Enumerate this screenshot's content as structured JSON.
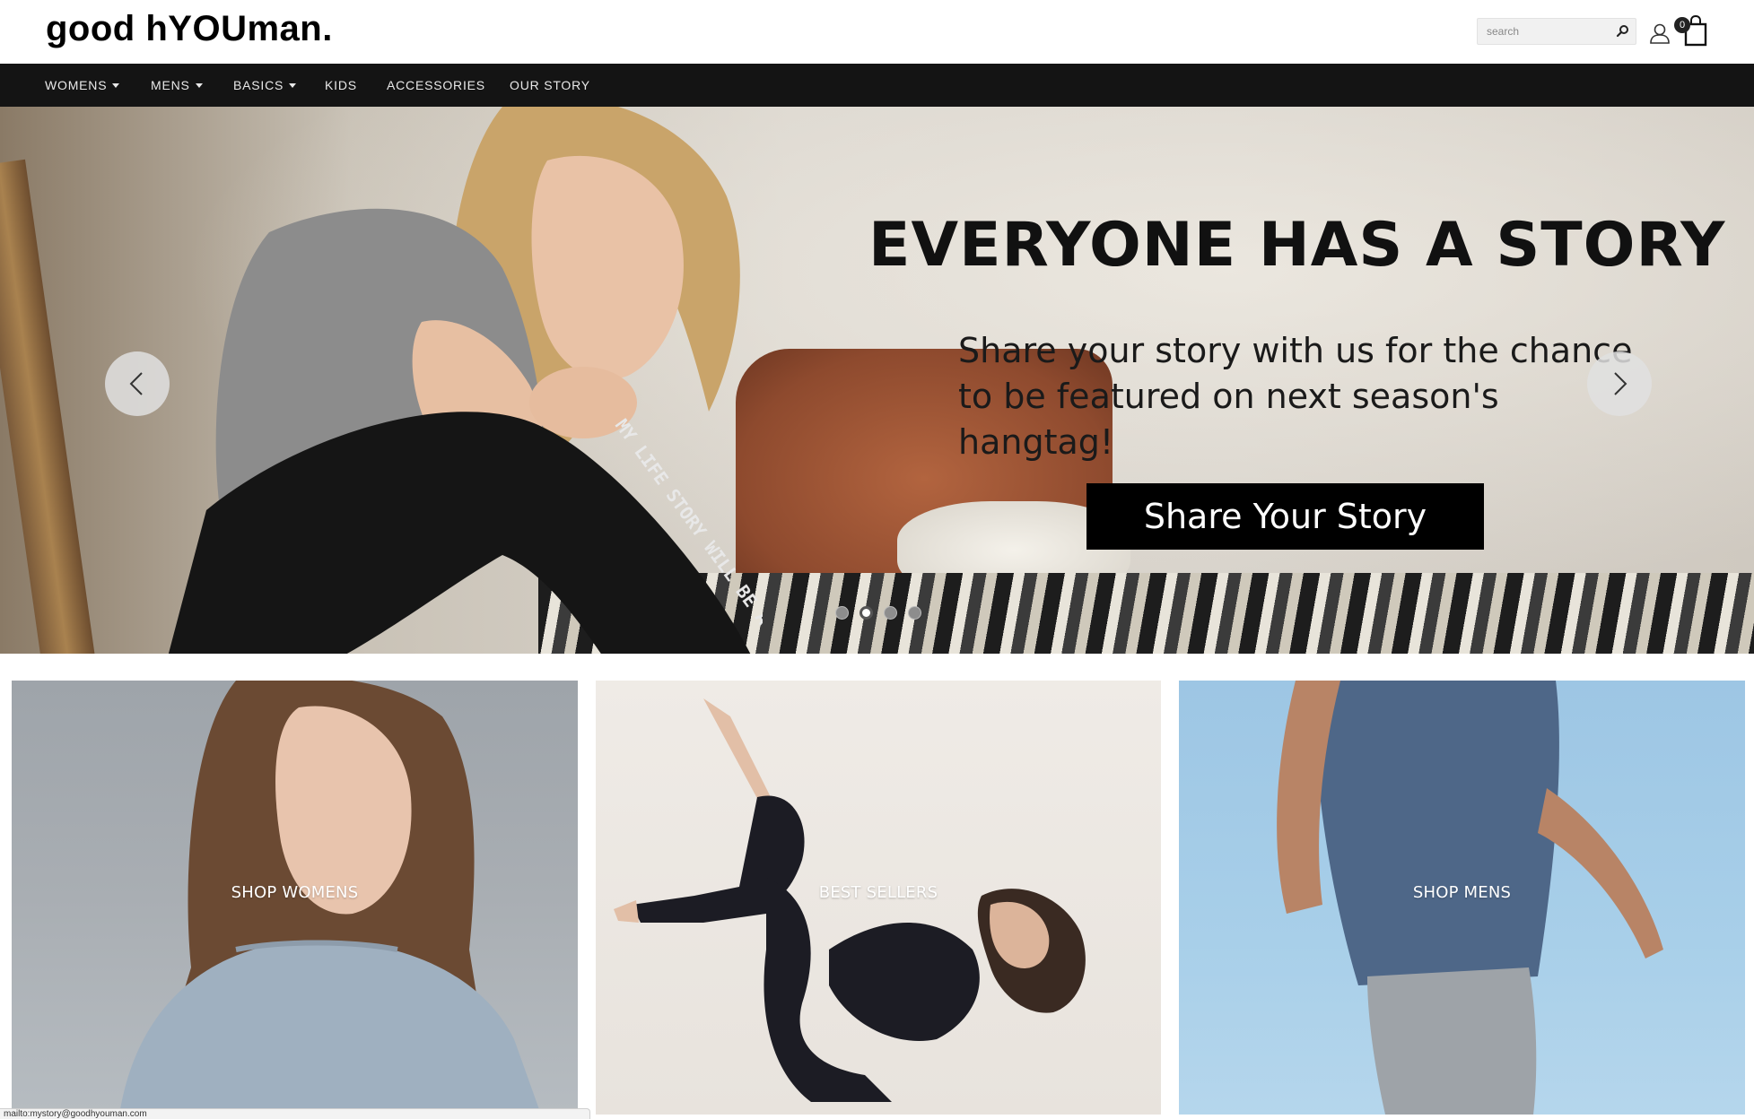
{
  "header": {
    "logo": "good hYOUman.",
    "search": {
      "placeholder": "search",
      "button_icon": "search-icon"
    },
    "account_icon": "user-icon",
    "cart": {
      "icon": "shopping-bag-icon",
      "count": "0"
    }
  },
  "nav": {
    "items": [
      {
        "label": "WOMENS",
        "has_dropdown": true
      },
      {
        "label": "MENS",
        "has_dropdown": true
      },
      {
        "label": "BASICS",
        "has_dropdown": true
      },
      {
        "label": "KIDS",
        "has_dropdown": false
      },
      {
        "label": "ACCESSORIES",
        "has_dropdown": false
      },
      {
        "label": "OUR STORY",
        "has_dropdown": false
      }
    ]
  },
  "hero": {
    "headline": "EVERYONE HAS A STORY",
    "subline_1": "Share your story with us for the chance",
    "subline_2": "to be featured on next season's hangtag!",
    "cta": "Share Your Story",
    "prev_icon": "chevron-left-icon",
    "next_icon": "chevron-right-icon",
    "slide_count": 4,
    "active_slide": 2,
    "leg_print": "MY LIFE STORY WILL BE A GO"
  },
  "tiles": [
    {
      "label": "SHOP WOMENS"
    },
    {
      "label": "BEST SELLERS"
    },
    {
      "label": "SHOP MENS"
    }
  ],
  "status_bar": {
    "text": "mailto:mystory@goodhyouman.com"
  },
  "colors": {
    "nav_bg": "#141414",
    "cta_bg": "#000000",
    "text_on_dark": "#ffffff"
  }
}
